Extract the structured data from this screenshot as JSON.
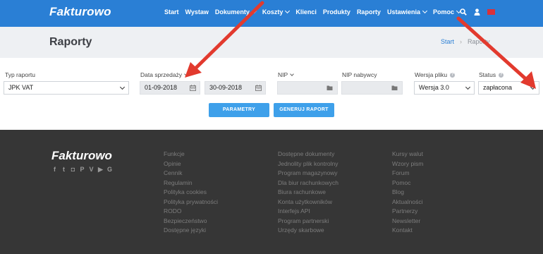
{
  "app": {
    "logo": "Fakturowo"
  },
  "nav": {
    "items": [
      {
        "label": "Start",
        "dropdown": false
      },
      {
        "label": "Wystaw",
        "dropdown": false
      },
      {
        "label": "Dokumenty",
        "dropdown": true
      },
      {
        "label": "Koszty",
        "dropdown": true
      },
      {
        "label": "Klienci",
        "dropdown": false
      },
      {
        "label": "Produkty",
        "dropdown": false
      },
      {
        "label": "Raporty",
        "dropdown": false
      },
      {
        "label": "Ustawienia",
        "dropdown": true
      },
      {
        "label": "Pomoc",
        "dropdown": true
      }
    ],
    "icons": [
      "search-icon",
      "user-icon",
      "flag-icon"
    ]
  },
  "header": {
    "title": "Raporty",
    "breadcrumb": {
      "home": "Start",
      "separator": "›",
      "current": "Raporty"
    }
  },
  "form": {
    "report_type": {
      "label": "Typ raportu",
      "value": "JPK VAT"
    },
    "sale_date": {
      "label": "Data sprzedaży",
      "from": "01-09-2018",
      "to": "30-09-2018"
    },
    "nip": {
      "label": "NIP",
      "value": ""
    },
    "buyer_nip": {
      "label": "NIP nabywcy",
      "value": ""
    },
    "file_version": {
      "label": "Wersja pliku",
      "value": "Wersja 3.0"
    },
    "status": {
      "label": "Status",
      "value": "zapłacona"
    },
    "buttons": {
      "params": "PARAMETRY",
      "generate": "GENERUJ RAPORT"
    }
  },
  "footer": {
    "logo": "Fakturowo",
    "social": [
      "f",
      "t",
      "◘",
      "P",
      "V",
      "▶",
      "G"
    ],
    "col1": [
      "Funkcje",
      "Opinie",
      "Cennik",
      "Regulamin",
      "Polityka cookies",
      "Polityka prywatności",
      "RODO",
      "Bezpieczeństwo",
      "Dostępne języki"
    ],
    "col2": [
      "Dostępne dokumenty",
      "Jednolity plik kontrolny",
      "Program magazynowy",
      "Dla biur rachunkowych",
      "Biura rachunkowe",
      "Konta użytkowników",
      "Interfejs API",
      "Program partnerski",
      "Urzędy skarbowe"
    ],
    "col3": [
      "Kursy walut",
      "Wzory pism",
      "Forum",
      "Pomoc",
      "Blog",
      "Aktualności",
      "Partnerzy",
      "Newsletter",
      "Kontakt"
    ]
  },
  "colors": {
    "nav": "#2a7fd5",
    "button": "#3ea0ea",
    "footer": "#363636",
    "arrow": "#e23a2e"
  }
}
